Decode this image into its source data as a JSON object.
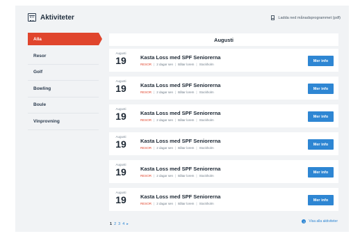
{
  "header": {
    "title": "Aktiviteter",
    "icon": "calendar-icon",
    "download_label": "Ladda ned månadsprogrammet (pdf)",
    "download_icon": "document-icon"
  },
  "sidebar": {
    "items": [
      {
        "label": "Alla",
        "active": true
      },
      {
        "label": "Resor",
        "active": false
      },
      {
        "label": "Golf",
        "active": false
      },
      {
        "label": "Bowling",
        "active": false
      },
      {
        "label": "Boule",
        "active": false
      },
      {
        "label": "Vinprovning",
        "active": false
      }
    ]
  },
  "main": {
    "month_label": "Augusti",
    "events": [
      {
        "month": "Augusti",
        "day": "19",
        "title": "Kasta Loss med SPF Seniorerna",
        "tag": "RESOR",
        "deadline": "2 dagar sen",
        "organizer": "Båtar lorem",
        "location": "Stockholm",
        "button_label": "Mer info"
      },
      {
        "month": "Augusti",
        "day": "19",
        "title": "Kasta Loss med SPF Seniorerna",
        "tag": "RESOR",
        "deadline": "2 dagar sen",
        "organizer": "Båtar lorem",
        "location": "Stockholm",
        "button_label": "Mer info"
      },
      {
        "month": "Augusti",
        "day": "19",
        "title": "Kasta Loss med SPF Seniorerna",
        "tag": "RESOR",
        "deadline": "2 dagar sen",
        "organizer": "Båtar lorem",
        "location": "Stockholm",
        "button_label": "Mer info"
      },
      {
        "month": "Augusti",
        "day": "19",
        "title": "Kasta Loss med SPF Seniorerna",
        "tag": "RESOR",
        "deadline": "2 dagar sen",
        "organizer": "Båtar lorem",
        "location": "Stockholm",
        "button_label": "Mer info"
      },
      {
        "month": "Augusti",
        "day": "19",
        "title": "Kasta Loss med SPF Seniorerna",
        "tag": "RESOR",
        "deadline": "2 dagar sen",
        "organizer": "Båtar lorem",
        "location": "Stockholm",
        "button_label": "Mer info"
      },
      {
        "month": "Augusti",
        "day": "19",
        "title": "Kasta Loss med SPF Seniorerna",
        "tag": "RESOR",
        "deadline": "2 dagar sen",
        "organizer": "Båtar lorem",
        "location": "Stockholm",
        "button_label": "Mer info"
      }
    ]
  },
  "pagination": {
    "pages": [
      "1",
      "2",
      "3",
      "4"
    ],
    "current": "1",
    "next_label": "▸"
  },
  "footer": {
    "all_activities_label": "Visa alla aktiviteter",
    "all_activities_icon": "info-icon"
  },
  "colors": {
    "accent": "#e0452d",
    "button": "#2e86d3",
    "background": "#f1f3f5"
  }
}
